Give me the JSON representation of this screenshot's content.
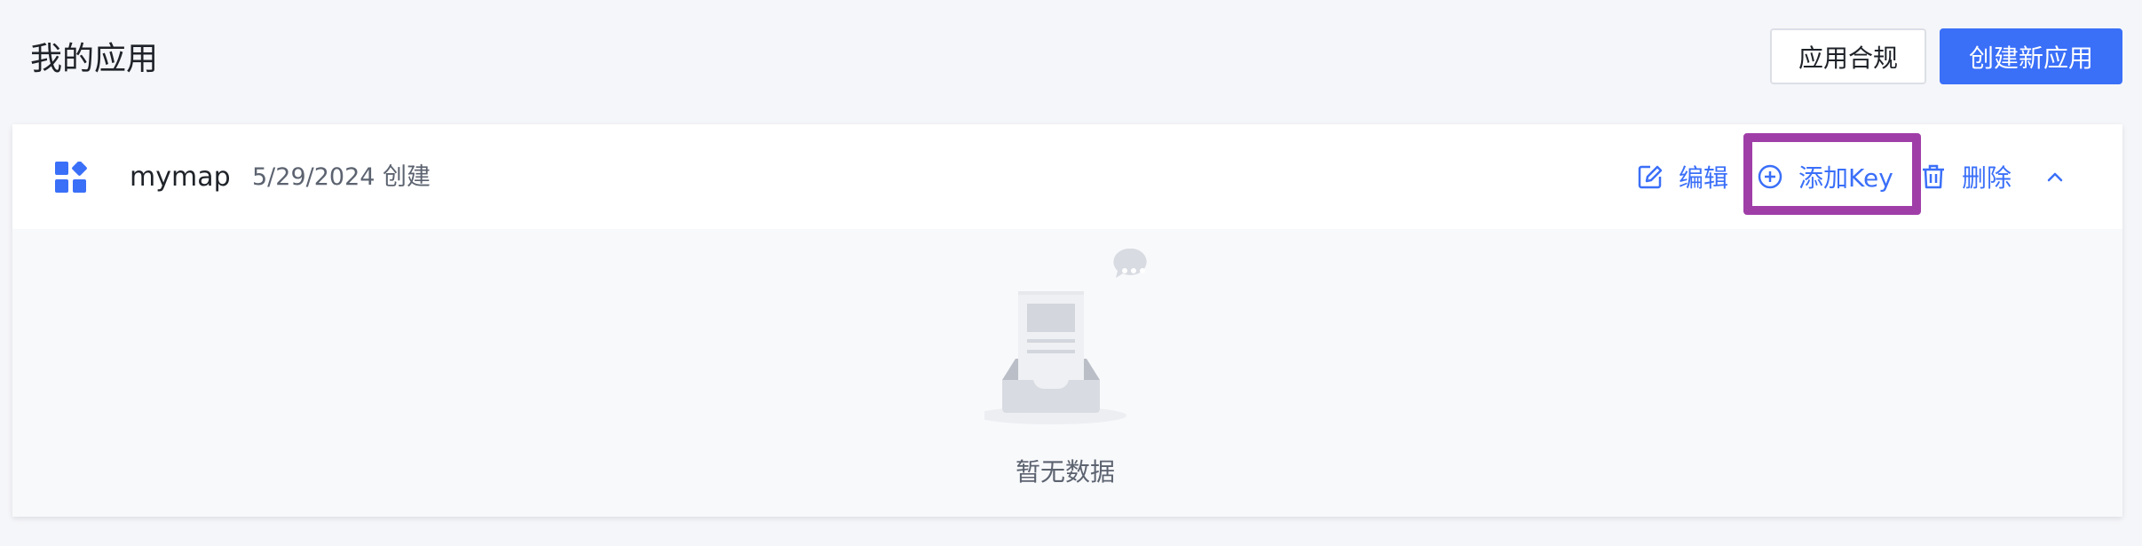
{
  "header": {
    "title": "我的应用",
    "compliance_label": "应用合规",
    "create_label": "创建新应用"
  },
  "app": {
    "name": "mymap",
    "created": "5/29/2024 创建",
    "icon": "app-grid-icon",
    "actions": {
      "edit_label": "编辑",
      "add_key_label": "添加Key",
      "delete_label": "删除",
      "edit_icon": "edit-icon",
      "add_key_icon": "plus-circle-icon",
      "delete_icon": "trash-icon",
      "collapse_icon": "chevron-up-icon"
    },
    "empty_state": {
      "text": "暂无数据",
      "icon": "empty-inbox-icon"
    }
  },
  "colors": {
    "accent": "#3a6ff8",
    "highlight": "#a03ea8",
    "background": "#f5f6f9"
  }
}
